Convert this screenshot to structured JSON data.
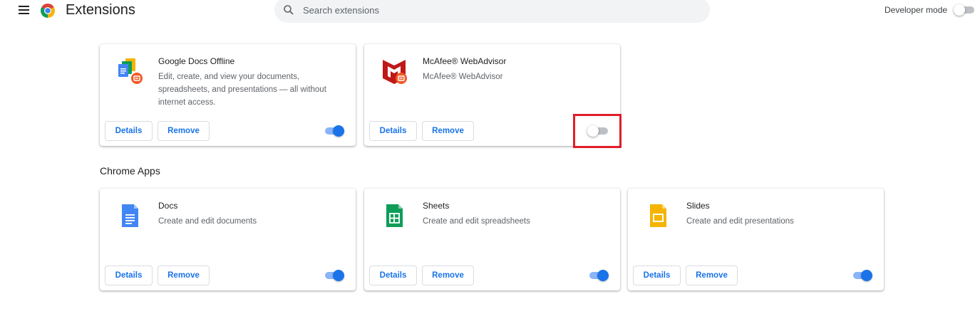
{
  "header": {
    "title": "Extensions",
    "search_placeholder": "Search extensions",
    "developer_mode_label": "Developer mode",
    "developer_mode_on": false
  },
  "extensions": [
    {
      "name": "Google Docs Offline",
      "description": "Edit, create, and view your documents, spreadsheets, and presentations — all without internet access.",
      "details_label": "Details",
      "remove_label": "Remove",
      "enabled": true,
      "icon": "google-docs-offline-icon"
    },
    {
      "name": "McAfee® WebAdvisor",
      "description": "McAfee® WebAdvisor",
      "details_label": "Details",
      "remove_label": "Remove",
      "enabled": false,
      "icon": "mcafee-icon"
    }
  ],
  "chrome_apps": {
    "heading": "Chrome Apps",
    "items": [
      {
        "name": "Docs",
        "description": "Create and edit documents",
        "details_label": "Details",
        "remove_label": "Remove",
        "enabled": true,
        "icon": "docs-icon"
      },
      {
        "name": "Sheets",
        "description": "Create and edit spreadsheets",
        "details_label": "Details",
        "remove_label": "Remove",
        "enabled": true,
        "icon": "sheets-icon"
      },
      {
        "name": "Slides",
        "description": "Create and edit presentations",
        "details_label": "Details",
        "remove_label": "Remove",
        "enabled": true,
        "icon": "slides-icon"
      }
    ]
  },
  "colors": {
    "accent": "#1a73e8",
    "toggle_track_on": "#8ab4f8",
    "highlight": "#e11d2a"
  }
}
